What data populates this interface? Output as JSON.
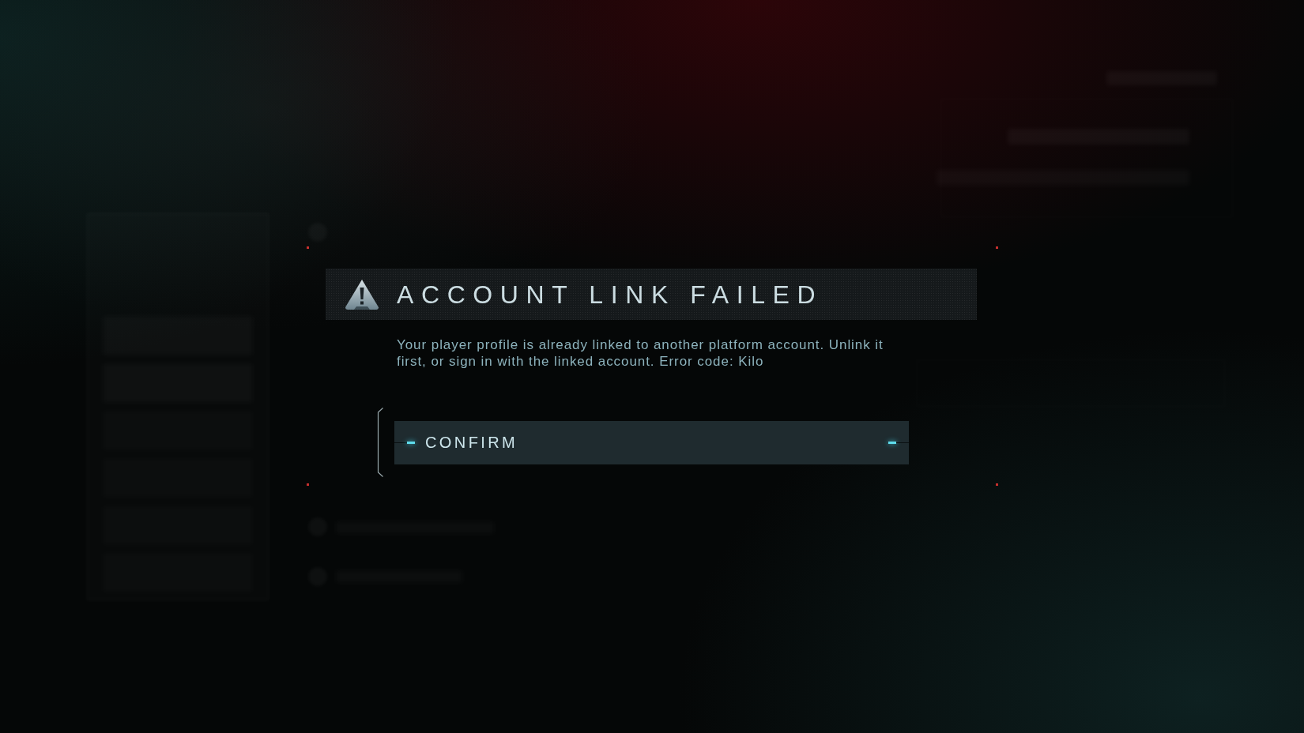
{
  "dialog": {
    "title": "ACCOUNT LINK FAILED",
    "message": "Your player profile is already linked to another platform account. Unlink it first, or sign in with the linked account. Error code: Kilo",
    "buttons": [
      {
        "label": "CONFIRM",
        "selected": true
      }
    ]
  }
}
